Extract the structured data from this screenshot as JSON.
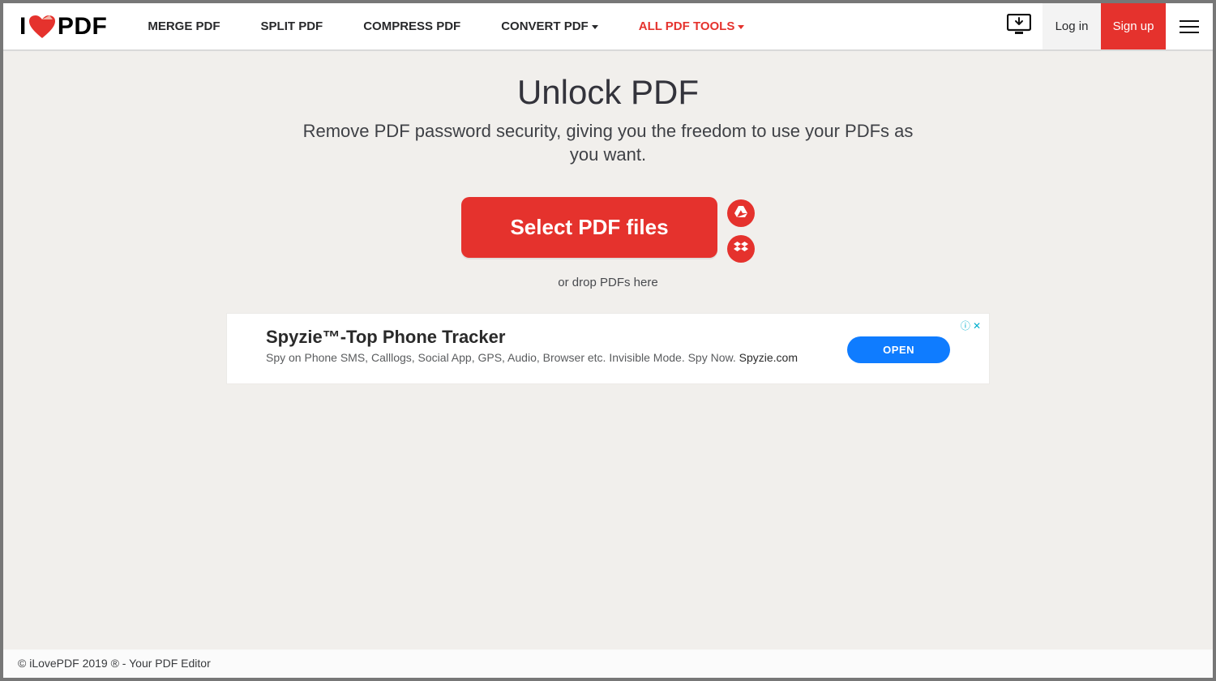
{
  "colors": {
    "accent": "#e5322d",
    "adButton": "#0f7cff"
  },
  "header": {
    "logo": {
      "prefix": "I",
      "suffix": "PDF"
    },
    "nav": {
      "merge": "MERGE PDF",
      "split": "SPLIT PDF",
      "compress": "COMPRESS PDF",
      "convert": "CONVERT PDF",
      "all_tools": "ALL PDF TOOLS"
    },
    "login": "Log in",
    "signup": "Sign up"
  },
  "main": {
    "title": "Unlock PDF",
    "subtitle": "Remove PDF password security, giving you the freedom to use your PDFs as you want.",
    "select_button": "Select PDF files",
    "drop_hint": "or drop PDFs here"
  },
  "ad": {
    "title": "Spyzie™-Top Phone Tracker",
    "description": "Spy on Phone SMS, Calllogs, Social App, GPS, Audio, Browser etc. Invisible Mode. Spy Now. ",
    "source": "Spyzie.com",
    "cta": "OPEN"
  },
  "footer": {
    "text": "© iLovePDF 2019 ® - Your PDF Editor"
  }
}
